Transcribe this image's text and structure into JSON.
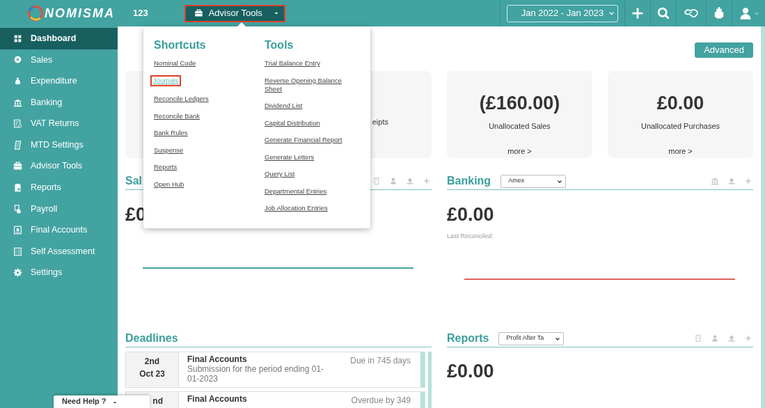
{
  "topbar": {
    "logo": "NOMISMA",
    "company": "123",
    "menu_button": {
      "label": "Advisor Tools",
      "expanded": true
    },
    "date_range": "Jan 2022 - Jan 2023"
  },
  "sidebar": {
    "items": [
      {
        "label": "Dashboard",
        "selected": true
      },
      {
        "label": "Sales",
        "selected": false
      },
      {
        "label": "Expenditure",
        "selected": false
      },
      {
        "label": "Banking",
        "selected": false
      },
      {
        "label": "VAT Returns",
        "selected": false
      },
      {
        "label": "MTD Settings",
        "selected": false
      },
      {
        "label": "Advisor Tools",
        "selected": false
      },
      {
        "label": "Reports",
        "selected": false
      },
      {
        "label": "Payroll",
        "selected": false
      },
      {
        "label": "Final Accounts",
        "selected": false
      },
      {
        "label": "Self Assessment",
        "selected": false
      },
      {
        "label": "Settings",
        "selected": false
      }
    ]
  },
  "advanced_button": "Advanced",
  "dropdown": {
    "columns": [
      {
        "title": "Shortcuts",
        "links": [
          {
            "label": "Nominal Code",
            "selected": false
          },
          {
            "label": "Journals",
            "selected": true
          },
          {
            "label": "Reconcile Ledgers",
            "selected": false
          },
          {
            "label": "Reconcile Bank",
            "selected": false
          },
          {
            "label": "Bank Rules",
            "selected": false
          },
          {
            "label": "Suspense",
            "selected": false
          },
          {
            "label": "Reports",
            "selected": false
          },
          {
            "label": "Open Hub",
            "selected": false
          }
        ]
      },
      {
        "title": "Tools",
        "links": [
          {
            "label": "Trial Balance Entry",
            "selected": false
          },
          {
            "label": "Reverse Opening Balance Sheet",
            "selected": false
          },
          {
            "label": "Dividend List",
            "selected": false
          },
          {
            "label": "Capital Distribution",
            "selected": false
          },
          {
            "label": "Generate Financial Report",
            "selected": false
          },
          {
            "label": "Generate Letters",
            "selected": false
          },
          {
            "label": "Query List",
            "selected": false
          },
          {
            "label": "Departmental Entries",
            "selected": false
          },
          {
            "label": "Job Allocation Entries",
            "selected": false
          }
        ]
      }
    ]
  },
  "cards": [
    {
      "kind": "covered"
    },
    {
      "kind": "covered",
      "label": "eipts"
    },
    {
      "kind": "full",
      "value": "(£160.00)",
      "label": "Unallocated Sales",
      "link": "more >"
    },
    {
      "kind": "full",
      "value": "£0.00",
      "label": "Unallocated Purchases",
      "link": "more >"
    }
  ],
  "sales": {
    "title": "Sal",
    "value": "£0"
  },
  "banking": {
    "title": "Banking",
    "account": "Amex",
    "value": "£0.00",
    "note": "Last Reconciled:"
  },
  "deadlines": {
    "title": "Deadlines",
    "items": [
      {
        "day": "2nd",
        "month": "Oct 23",
        "title": "Final Accounts",
        "description": "Submission for the period ending 01-01-2023",
        "due": "Due in 745 days"
      },
      {
        "day": "nd",
        "title": "Final Accounts",
        "due": "Overdue by 349"
      }
    ]
  },
  "reports": {
    "title": "Reports",
    "filter": "Profit After Ta",
    "value": "£0.00"
  },
  "help_tab": "Need Help ?"
}
